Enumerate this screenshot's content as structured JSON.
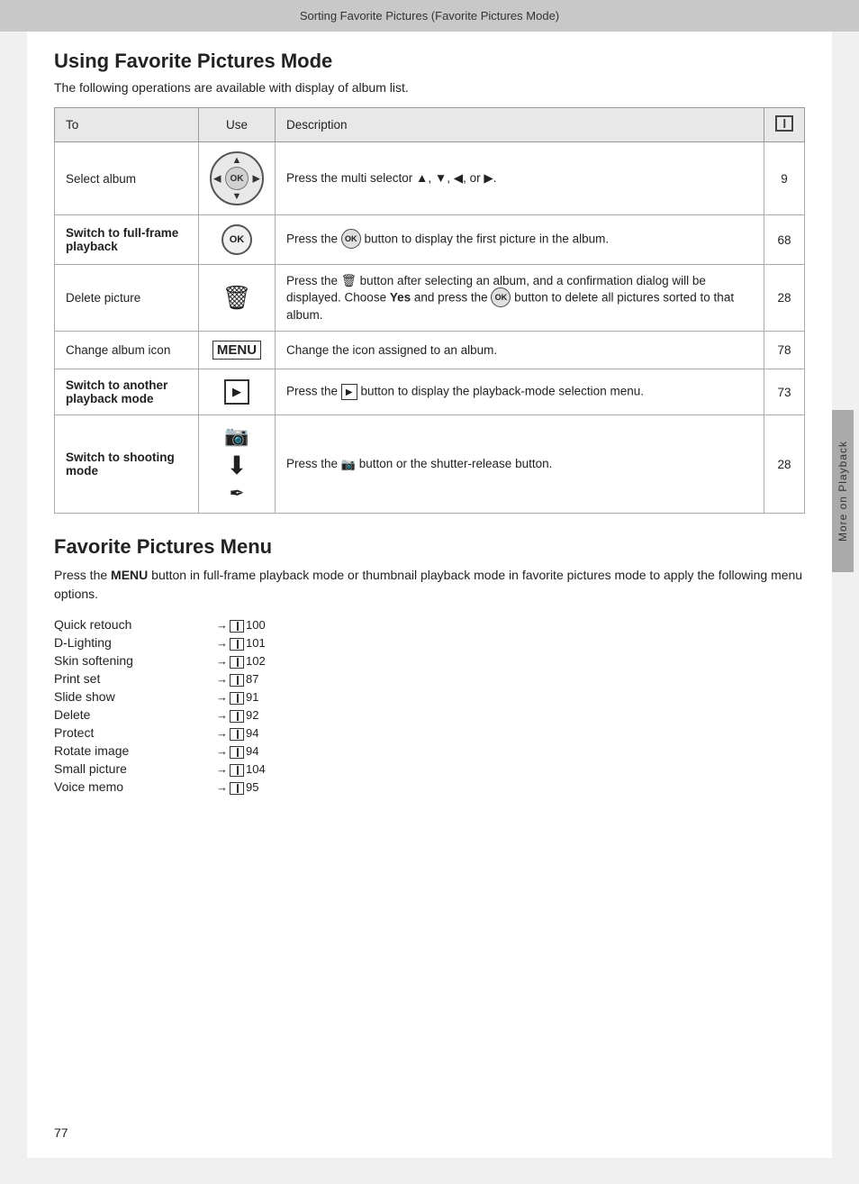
{
  "header": {
    "title": "Sorting Favorite Pictures (Favorite Pictures Mode)"
  },
  "section1": {
    "title": "Using Favorite Pictures Mode",
    "intro": "The following operations are available with display of album list.",
    "table": {
      "columns": [
        "To",
        "Use",
        "Description",
        "ref_icon"
      ],
      "rows": [
        {
          "to": "Select album",
          "use": "ok_dial",
          "description": "Press the multi selector ▲, ▼, ◀, or ▶.",
          "ref": "9"
        },
        {
          "to": "Switch to full-frame playback",
          "use": "ok_btn",
          "description": "Press the ⊛ button to display the first picture in the album.",
          "ref": "68"
        },
        {
          "to": "Delete picture",
          "use": "trash",
          "description": "Press the 🗑 button after selecting an album, and a confirmation dialog will be displayed. Choose Yes and press the ⊛ button to delete all pictures sorted to that album.",
          "ref": "28"
        },
        {
          "to": "Change album icon",
          "use": "menu",
          "description": "Change the icon assigned to an album.",
          "ref": "78"
        },
        {
          "to": "Switch to another playback mode",
          "use": "play_btn",
          "description": "Press the ▶ button to display the playback-mode selection menu.",
          "ref": "73"
        },
        {
          "to": "Switch to shooting mode",
          "use": "camera_shutter",
          "description": "Press the 📷 button or the shutter-release button.",
          "ref": "28"
        }
      ]
    }
  },
  "section2": {
    "title": "Favorite Pictures Menu",
    "intro": "Press the MENU button in full-frame playback mode or thumbnail playback mode in favorite pictures mode to apply the following menu options.",
    "items": [
      {
        "label": "Quick retouch",
        "ref": "100"
      },
      {
        "label": "D-Lighting",
        "ref": "101"
      },
      {
        "label": "Skin softening",
        "ref": "102"
      },
      {
        "label": "Print set",
        "ref": "87"
      },
      {
        "label": "Slide show",
        "ref": "91"
      },
      {
        "label": "Delete",
        "ref": "92"
      },
      {
        "label": "Protect",
        "ref": "94"
      },
      {
        "label": "Rotate image",
        "ref": "94"
      },
      {
        "label": "Small picture",
        "ref": "104"
      },
      {
        "label": "Voice memo",
        "ref": "95"
      }
    ]
  },
  "side_tab": "More on Playback",
  "page_number": "77"
}
